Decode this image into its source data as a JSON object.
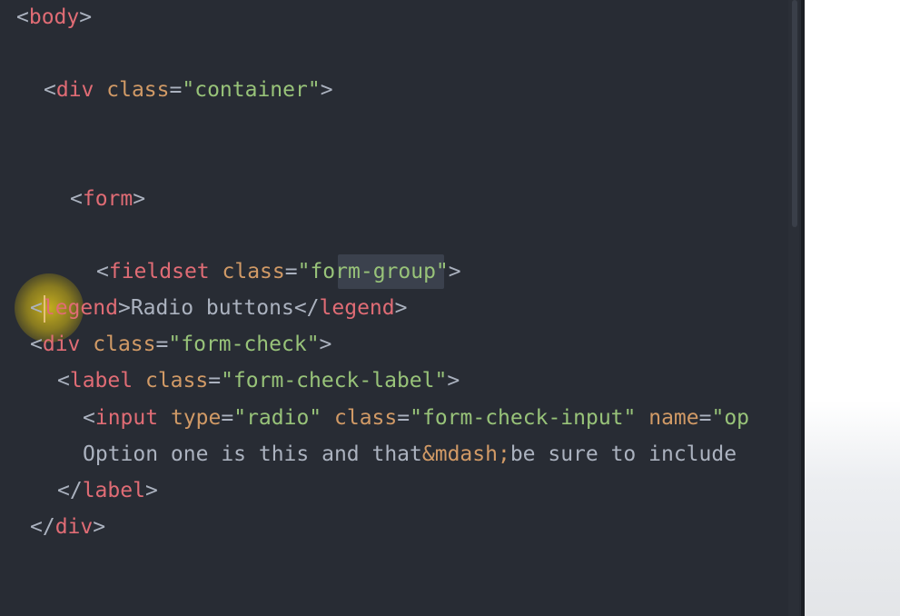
{
  "editor": {
    "lines": [
      {
        "tokens": [
          {
            "t": "<",
            "c": "punct"
          },
          {
            "t": "body",
            "c": "tag"
          },
          {
            "t": ">",
            "c": "punct"
          }
        ]
      },
      {
        "tokens": [
          {
            "t": "<",
            "c": "punct"
          },
          {
            "t": "div",
            "c": "tag"
          },
          {
            "t": " ",
            "c": "text"
          },
          {
            "t": "class",
            "c": "attr"
          },
          {
            "t": "=",
            "c": "punct"
          },
          {
            "t": "\"container\"",
            "c": "string"
          },
          {
            "t": ">",
            "c": "punct"
          }
        ]
      },
      {
        "tokens": [
          {
            "t": "<",
            "c": "punct"
          },
          {
            "t": "form",
            "c": "tag"
          },
          {
            "t": ">",
            "c": "punct"
          }
        ]
      },
      {
        "tokens": [
          {
            "t": "<",
            "c": "punct"
          },
          {
            "t": "fieldset",
            "c": "tag"
          },
          {
            "t": " ",
            "c": "text"
          },
          {
            "t": "class",
            "c": "attr"
          },
          {
            "t": "=",
            "c": "punct"
          },
          {
            "t": "\"form-group\"",
            "c": "string"
          },
          {
            "t": ">",
            "c": "punct"
          }
        ]
      },
      {
        "tokens": [
          {
            "t": "<",
            "c": "punct"
          },
          {
            "t": "legend",
            "c": "tag"
          },
          {
            "t": ">",
            "c": "punct"
          },
          {
            "t": "Radio buttons",
            "c": "text"
          },
          {
            "t": "</",
            "c": "punct"
          },
          {
            "t": "legend",
            "c": "tag"
          },
          {
            "t": ">",
            "c": "punct"
          }
        ]
      },
      {
        "tokens": [
          {
            "t": "<",
            "c": "punct"
          },
          {
            "t": "div",
            "c": "tag"
          },
          {
            "t": " ",
            "c": "text"
          },
          {
            "t": "class",
            "c": "attr"
          },
          {
            "t": "=",
            "c": "punct"
          },
          {
            "t": "\"form-check\"",
            "c": "string"
          },
          {
            "t": ">",
            "c": "punct"
          }
        ]
      },
      {
        "tokens": [
          {
            "t": "<",
            "c": "punct"
          },
          {
            "t": "label",
            "c": "tag"
          },
          {
            "t": " ",
            "c": "text"
          },
          {
            "t": "class",
            "c": "attr"
          },
          {
            "t": "=",
            "c": "punct"
          },
          {
            "t": "\"form-check-label\"",
            "c": "string"
          },
          {
            "t": ">",
            "c": "punct"
          }
        ]
      },
      {
        "tokens": [
          {
            "t": "<",
            "c": "punct"
          },
          {
            "t": "input",
            "c": "tag"
          },
          {
            "t": " ",
            "c": "text"
          },
          {
            "t": "type",
            "c": "attr"
          },
          {
            "t": "=",
            "c": "punct"
          },
          {
            "t": "\"radio\"",
            "c": "string"
          },
          {
            "t": " ",
            "c": "text"
          },
          {
            "t": "class",
            "c": "attr"
          },
          {
            "t": "=",
            "c": "punct"
          },
          {
            "t": "\"form-check-input\"",
            "c": "string"
          },
          {
            "t": " ",
            "c": "text"
          },
          {
            "t": "name",
            "c": "attr"
          },
          {
            "t": "=",
            "c": "punct"
          },
          {
            "t": "\"op",
            "c": "string"
          }
        ]
      },
      {
        "tokens": [
          {
            "t": "Option one is this and that",
            "c": "text"
          },
          {
            "t": "&mdash;",
            "c": "entity"
          },
          {
            "t": "be sure to include",
            "c": "text"
          }
        ]
      },
      {
        "tokens": [
          {
            "t": "</",
            "c": "punct"
          },
          {
            "t": "label",
            "c": "tag"
          },
          {
            "t": ">",
            "c": "punct"
          }
        ]
      },
      {
        "tokens": [
          {
            "t": "</",
            "c": "punct"
          },
          {
            "t": "div",
            "c": "tag"
          },
          {
            "t": ">",
            "c": "punct"
          }
        ]
      }
    ]
  },
  "colors": {
    "background": "#282c34",
    "tag": "#e06c75",
    "attribute": "#d19a66",
    "string": "#98c379",
    "text": "#abb2bf",
    "cursor_highlight": "#c8b01e"
  }
}
